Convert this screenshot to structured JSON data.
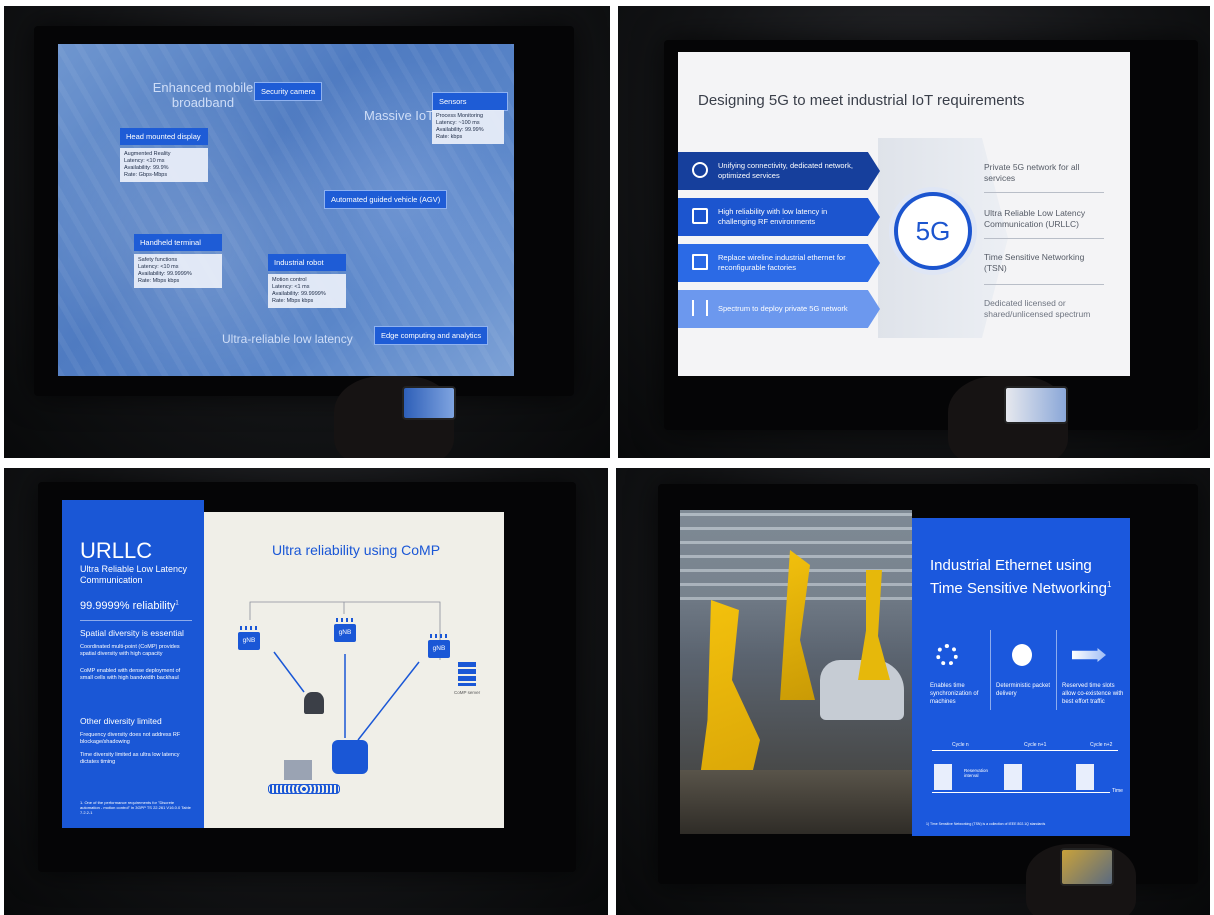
{
  "slide1": {
    "zones": [
      "Enhanced mobile broadband",
      "Massive IoT",
      "Ultra-reliable low latency"
    ],
    "tags": {
      "security_camera": "Security camera",
      "sensors": "Sensors",
      "agv": "Automated guided vehicle (AGV)",
      "edge": "Edge computing and analytics"
    },
    "cards": {
      "hmd": {
        "title": "Head mounted display",
        "lines": [
          "Augmented Reality",
          "Latency:      <10 ms",
          "Availability:   99.9%",
          "Rate:         Gbps-Mbps"
        ]
      },
      "terminal": {
        "title": "Handheld terminal",
        "lines": [
          "Safety functions",
          "Latency:      <10 ms",
          "Availability:   99.9999%",
          "Rate:         Mbps kbps"
        ]
      },
      "robot": {
        "title": "Industrial robot",
        "lines": [
          "Motion control",
          "Latency:      <1 ms",
          "Availability:  99.9999%",
          "Rate:         Mbps kbps"
        ]
      },
      "sensors": {
        "lines": [
          "Process Monitoring",
          "Latency:      ~100 ms",
          "Availability:  99.99%",
          "Rate:         kbps"
        ]
      }
    }
  },
  "slide2": {
    "title": "Designing 5G to meet industrial IoT requirements",
    "left_items": [
      "Unifying connectivity, dedicated network, optimized services",
      "High reliability with low latency in challenging RF environments",
      "Replace wireline industrial ethernet for reconfigurable factories",
      "Spectrum to deploy private 5G network"
    ],
    "center": "5G",
    "right_items": [
      "Private 5G network for all services",
      "Ultra Reliable Low Latency Communication (URLLC)",
      "Time Sensitive Networking (TSN)",
      "Dedicated licensed or shared/unlicensed spectrum"
    ],
    "colors": [
      "#163f9c",
      "#1c55cf",
      "#2b6ae6",
      "#6c98ee"
    ]
  },
  "slide3": {
    "heading": "URLLC",
    "subheading": "Ultra Reliable Low Latency Communication",
    "reliability": "99.9999% reliability",
    "reliability_sup": "1",
    "section1": "Spatial diversity is essential",
    "bullets1": [
      "Coordinated multi-point (CoMP) provides spatial diversity with high capacity",
      "CoMP enabled with dense deployment of small cells with high bandwidth backhaul"
    ],
    "section2": "Other diversity limited",
    "bullets2": [
      "Frequency diversity does not address RF blockage/shadowing",
      "Time diversity limited as ultra low latency dictates timing"
    ],
    "footnote": "1. One of the performance requirements for \"Discrete automation - motion control\" in 3GPP TS 22.261 V16.0.0 Table 7.2.2-1",
    "title": "Ultra reliability using CoMP",
    "gnb_label": "gNB",
    "server_label": "CoMP server"
  },
  "slide4": {
    "title": "Industrial Ethernet using Time Sensitive Networking",
    "title_sup": "1",
    "features": [
      "Enables time synchronization of machines",
      "Deterministic packet delivery",
      "Reserved time slots allow co-existence with best effort traffic"
    ],
    "cycles": [
      "Cycle n",
      "Cycle n+1",
      "Cycle n+2"
    ],
    "reservation": "Reservation interval",
    "time_label": "Time",
    "footnote": "1) Time Sensitive Networking (TSN) is a collection of IEEE 802.1Q standards"
  }
}
